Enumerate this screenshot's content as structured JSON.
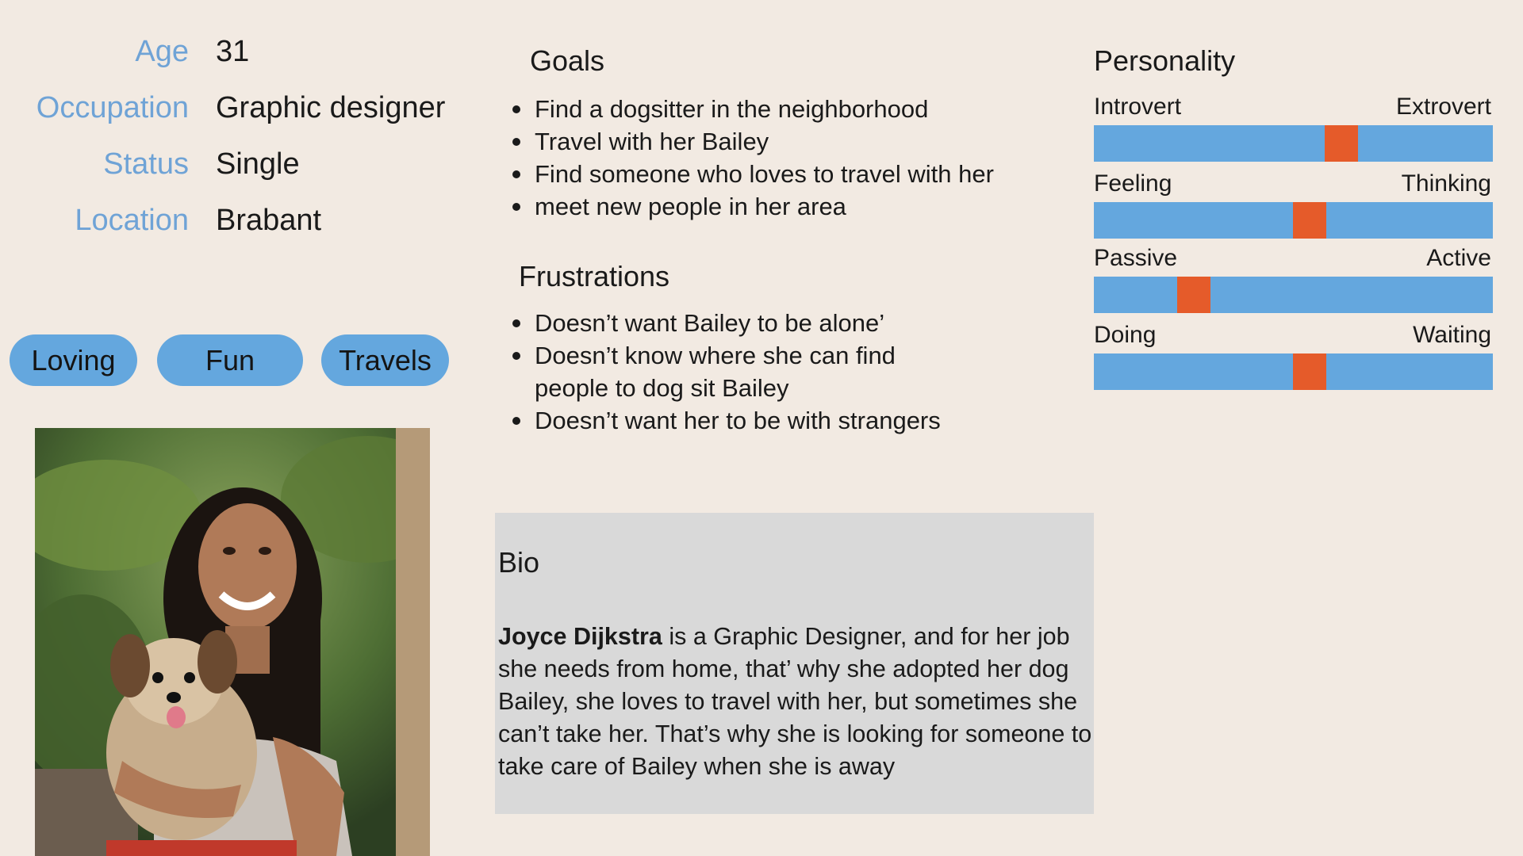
{
  "profile": {
    "age_label": "Age",
    "age": "31",
    "occupation_label": "Occupation",
    "occupation": "Graphic designer",
    "status_label": "Status",
    "status": "Single",
    "location_label": "Location",
    "location": "Brabant"
  },
  "tags": [
    "Loving",
    "Fun",
    "Travels"
  ],
  "goals": {
    "title": "Goals",
    "items": [
      "Find a dogsitter in the neighborhood",
      "Travel with her Bailey",
      "Find someone who loves to travel with her",
      "meet new people in her area"
    ]
  },
  "frustrations": {
    "title": "Frustrations",
    "items": [
      "Doesn’t want Bailey to be alone’",
      "Doesn’t know where she can find people to dog sit Bailey",
      "Doesn’t want her to be with strangers"
    ]
  },
  "bio": {
    "title": "Bio",
    "name": "Joyce Dijkstra",
    "text": " is a Graphic Designer, and for her job she needs from home, that’ why she adopted her dog Bailey, she loves to travel with her, but sometimes she can’t take her. That’s why she is looking for someone to take care of Bailey when she is away"
  },
  "personality": {
    "title": "Personality",
    "traits": [
      {
        "left": "Introvert",
        "right": "Extrovert",
        "value": 0.62
      },
      {
        "left": "Feeling",
        "right": "Thinking",
        "value": 0.54
      },
      {
        "left": "Passive",
        "right": "Active",
        "value": 0.25
      },
      {
        "left": "Doing",
        "right": "Waiting",
        "value": 0.54
      }
    ]
  },
  "colors": {
    "background": "#f2eae2",
    "label_blue": "#6fa3d6",
    "bar_blue": "#64a7de",
    "marker_orange": "#e55b2a",
    "bio_gray": "#d9d9d9"
  },
  "photo": {
    "icon": "persona-photo"
  }
}
